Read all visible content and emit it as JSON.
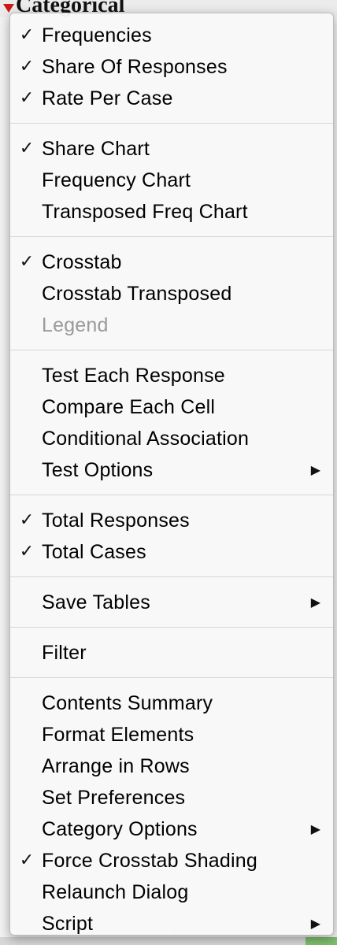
{
  "window": {
    "section_title": "Categorical"
  },
  "menu": {
    "groups": [
      [
        {
          "label": "Frequencies",
          "checked": true,
          "submenu": false,
          "enabled": true
        },
        {
          "label": "Share Of Responses",
          "checked": true,
          "submenu": false,
          "enabled": true
        },
        {
          "label": "Rate Per Case",
          "checked": true,
          "submenu": false,
          "enabled": true
        }
      ],
      [
        {
          "label": "Share Chart",
          "checked": true,
          "submenu": false,
          "enabled": true
        },
        {
          "label": "Frequency Chart",
          "checked": false,
          "submenu": false,
          "enabled": true
        },
        {
          "label": "Transposed Freq Chart",
          "checked": false,
          "submenu": false,
          "enabled": true
        }
      ],
      [
        {
          "label": "Crosstab",
          "checked": true,
          "submenu": false,
          "enabled": true
        },
        {
          "label": "Crosstab Transposed",
          "checked": false,
          "submenu": false,
          "enabled": true
        },
        {
          "label": "Legend",
          "checked": false,
          "submenu": false,
          "enabled": false
        }
      ],
      [
        {
          "label": "Test Each Response",
          "checked": false,
          "submenu": false,
          "enabled": true
        },
        {
          "label": "Compare Each Cell",
          "checked": false,
          "submenu": false,
          "enabled": true
        },
        {
          "label": "Conditional Association",
          "checked": false,
          "submenu": false,
          "enabled": true
        },
        {
          "label": "Test Options",
          "checked": false,
          "submenu": true,
          "enabled": true
        }
      ],
      [
        {
          "label": "Total Responses",
          "checked": true,
          "submenu": false,
          "enabled": true
        },
        {
          "label": "Total Cases",
          "checked": true,
          "submenu": false,
          "enabled": true
        }
      ],
      [
        {
          "label": "Save Tables",
          "checked": false,
          "submenu": true,
          "enabled": true
        }
      ],
      [
        {
          "label": "Filter",
          "checked": false,
          "submenu": false,
          "enabled": true
        }
      ],
      [
        {
          "label": "Contents Summary",
          "checked": false,
          "submenu": false,
          "enabled": true
        },
        {
          "label": "Format Elements",
          "checked": false,
          "submenu": false,
          "enabled": true
        },
        {
          "label": "Arrange in Rows",
          "checked": false,
          "submenu": false,
          "enabled": true
        },
        {
          "label": "Set Preferences",
          "checked": false,
          "submenu": false,
          "enabled": true
        },
        {
          "label": "Category Options",
          "checked": false,
          "submenu": true,
          "enabled": true
        },
        {
          "label": "Force Crosstab Shading",
          "checked": true,
          "submenu": false,
          "enabled": true
        },
        {
          "label": "Relaunch Dialog",
          "checked": false,
          "submenu": false,
          "enabled": true
        },
        {
          "label": "Script",
          "checked": false,
          "submenu": true,
          "enabled": true
        }
      ]
    ],
    "check_glyph": "✓",
    "submenu_glyph": "▶"
  },
  "colors": {
    "disclosure_triangle": "#d01818",
    "disabled_text": "#9a9a9a"
  }
}
